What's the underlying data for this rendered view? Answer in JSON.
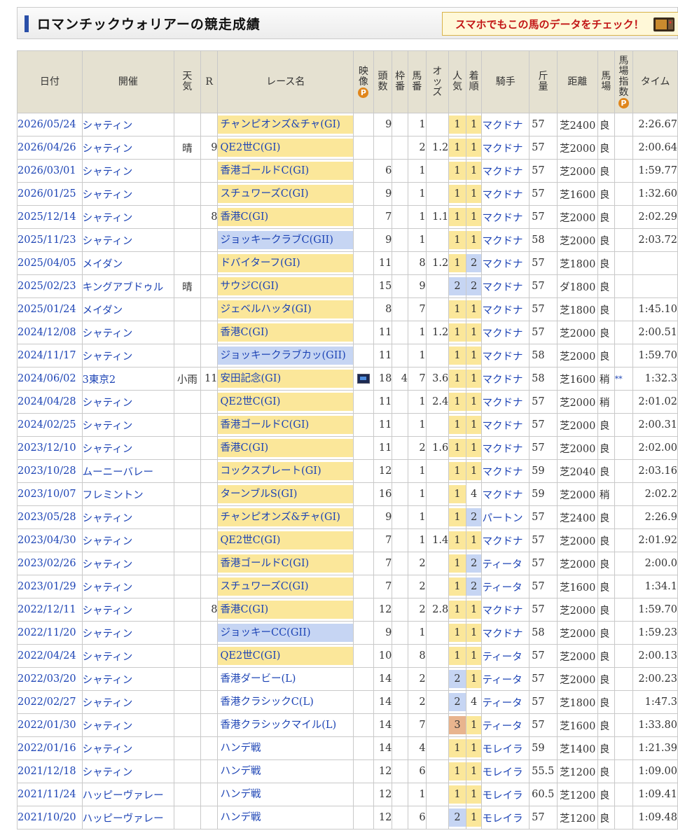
{
  "page": {
    "title": "ロマンチックウォリアーの競走成績"
  },
  "banner": {
    "text": "スマホでもこの馬のデータをチェック！"
  },
  "icons": {
    "premium": "P",
    "video": "video-icon"
  },
  "headers": {
    "date": "日付",
    "venue": "開催",
    "weather": "天気",
    "race_no": "R",
    "race_name": "レース名",
    "video": "映像",
    "field_size": "頭数",
    "gate": "枠番",
    "horse_no": "馬番",
    "odds": "オッズ",
    "popularity": "人気",
    "finish": "着順",
    "jockey": "騎手",
    "weight": "斤量",
    "distance": "距離",
    "track": "馬場",
    "speed_index": "馬場指数",
    "time": "タイム"
  },
  "rows": [
    {
      "date": "2026/05/24",
      "venue": "シャティン",
      "weather": "",
      "race_no": "",
      "race": "チャンピオンズ&チャ(GI)",
      "grade": "G1",
      "video": false,
      "field": "9",
      "gate": "",
      "horse_no": "1",
      "odds": "",
      "pop": "1",
      "finish": "1",
      "jockey": "マクドナ",
      "weight": "57",
      "distance": "芝2400",
      "track": "良",
      "index": "",
      "time": "2:26.67"
    },
    {
      "date": "2026/04/26",
      "venue": "シャティン",
      "weather": "晴",
      "race_no": "9",
      "race": "QE2世C(GI)",
      "grade": "G1",
      "video": false,
      "field": "",
      "gate": "",
      "horse_no": "2",
      "odds": "1.2",
      "pop": "1",
      "finish": "1",
      "jockey": "マクドナ",
      "weight": "57",
      "distance": "芝2000",
      "track": "良",
      "index": "",
      "time": "2:00.64"
    },
    {
      "date": "2026/03/01",
      "venue": "シャティン",
      "weather": "",
      "race_no": "",
      "race": "香港ゴールドC(GI)",
      "grade": "G1",
      "video": false,
      "field": "6",
      "gate": "",
      "horse_no": "1",
      "odds": "",
      "pop": "1",
      "finish": "1",
      "jockey": "マクドナ",
      "weight": "57",
      "distance": "芝2000",
      "track": "良",
      "index": "",
      "time": "1:59.77"
    },
    {
      "date": "2026/01/25",
      "venue": "シャティン",
      "weather": "",
      "race_no": "",
      "race": "スチュワーズC(GI)",
      "grade": "G1",
      "video": false,
      "field": "9",
      "gate": "",
      "horse_no": "1",
      "odds": "",
      "pop": "1",
      "finish": "1",
      "jockey": "マクドナ",
      "weight": "57",
      "distance": "芝1600",
      "track": "良",
      "index": "",
      "time": "1:32.60"
    },
    {
      "date": "2025/12/14",
      "venue": "シャティン",
      "weather": "",
      "race_no": "8",
      "race": "香港C(GI)",
      "grade": "G1",
      "video": false,
      "field": "7",
      "gate": "",
      "horse_no": "1",
      "odds": "1.1",
      "pop": "1",
      "finish": "1",
      "jockey": "マクドナ",
      "weight": "57",
      "distance": "芝2000",
      "track": "良",
      "index": "",
      "time": "2:02.29"
    },
    {
      "date": "2025/11/23",
      "venue": "シャティン",
      "weather": "",
      "race_no": "",
      "race": "ジョッキークラブC(GII)",
      "grade": "G2",
      "video": false,
      "field": "9",
      "gate": "",
      "horse_no": "1",
      "odds": "",
      "pop": "1",
      "finish": "1",
      "jockey": "マクドナ",
      "weight": "58",
      "distance": "芝2000",
      "track": "良",
      "index": "",
      "time": "2:03.72"
    },
    {
      "date": "2025/04/05",
      "venue": "メイダン",
      "weather": "",
      "race_no": "",
      "race": "ドバイターフ(GI)",
      "grade": "G1",
      "video": false,
      "field": "11",
      "gate": "",
      "horse_no": "8",
      "odds": "1.2",
      "pop": "1",
      "finish": "2",
      "jockey": "マクドナ",
      "weight": "57",
      "distance": "芝1800",
      "track": "良",
      "index": "",
      "time": ""
    },
    {
      "date": "2025/02/23",
      "venue": "キングアブドゥル",
      "weather": "晴",
      "race_no": "",
      "race": "サウジC(GI)",
      "grade": "G1",
      "video": false,
      "field": "15",
      "gate": "",
      "horse_no": "9",
      "odds": "",
      "pop": "2",
      "finish": "2",
      "jockey": "マクドナ",
      "weight": "57",
      "distance": "ダ1800",
      "track": "良",
      "index": "",
      "time": ""
    },
    {
      "date": "2025/01/24",
      "venue": "メイダン",
      "weather": "",
      "race_no": "",
      "race": "ジェベルハッタ(GI)",
      "grade": "G1",
      "video": false,
      "field": "8",
      "gate": "",
      "horse_no": "7",
      "odds": "",
      "pop": "1",
      "finish": "1",
      "jockey": "マクドナ",
      "weight": "57",
      "distance": "芝1800",
      "track": "良",
      "index": "",
      "time": "1:45.10"
    },
    {
      "date": "2024/12/08",
      "venue": "シャティン",
      "weather": "",
      "race_no": "",
      "race": "香港C(GI)",
      "grade": "G1",
      "video": false,
      "field": "11",
      "gate": "",
      "horse_no": "1",
      "odds": "1.2",
      "pop": "1",
      "finish": "1",
      "jockey": "マクドナ",
      "weight": "57",
      "distance": "芝2000",
      "track": "良",
      "index": "",
      "time": "2:00.51"
    },
    {
      "date": "2024/11/17",
      "venue": "シャティン",
      "weather": "",
      "race_no": "",
      "race": "ジョッキークラブカッ(GII)",
      "grade": "G2",
      "video": false,
      "field": "11",
      "gate": "",
      "horse_no": "1",
      "odds": "",
      "pop": "1",
      "finish": "1",
      "jockey": "マクドナ",
      "weight": "58",
      "distance": "芝2000",
      "track": "良",
      "index": "",
      "time": "1:59.70"
    },
    {
      "date": "2024/06/02",
      "venue": "3東京2",
      "weather": "小雨",
      "race_no": "11",
      "race": "安田記念(GI)",
      "grade": "G1",
      "video": true,
      "field": "18",
      "gate": "4",
      "horse_no": "7",
      "odds": "3.6",
      "pop": "1",
      "finish": "1",
      "jockey": "マクドナ",
      "weight": "58",
      "distance": "芝1600",
      "track": "稍",
      "index": "**",
      "time": "1:32.3"
    },
    {
      "date": "2024/04/28",
      "venue": "シャティン",
      "weather": "",
      "race_no": "",
      "race": "QE2世C(GI)",
      "grade": "G1",
      "video": false,
      "field": "11",
      "gate": "",
      "horse_no": "1",
      "odds": "2.4",
      "pop": "1",
      "finish": "1",
      "jockey": "マクドナ",
      "weight": "57",
      "distance": "芝2000",
      "track": "稍",
      "index": "",
      "time": "2:01.02"
    },
    {
      "date": "2024/02/25",
      "venue": "シャティン",
      "weather": "",
      "race_no": "",
      "race": "香港ゴールドC(GI)",
      "grade": "G1",
      "video": false,
      "field": "11",
      "gate": "",
      "horse_no": "1",
      "odds": "",
      "pop": "1",
      "finish": "1",
      "jockey": "マクドナ",
      "weight": "57",
      "distance": "芝2000",
      "track": "良",
      "index": "",
      "time": "2:00.31"
    },
    {
      "date": "2023/12/10",
      "venue": "シャティン",
      "weather": "",
      "race_no": "",
      "race": "香港C(GI)",
      "grade": "G1",
      "video": false,
      "field": "11",
      "gate": "",
      "horse_no": "2",
      "odds": "1.6",
      "pop": "1",
      "finish": "1",
      "jockey": "マクドナ",
      "weight": "57",
      "distance": "芝2000",
      "track": "良",
      "index": "",
      "time": "2:02.00"
    },
    {
      "date": "2023/10/28",
      "venue": "ムーニーバレー",
      "weather": "",
      "race_no": "",
      "race": "コックスプレート(GI)",
      "grade": "G1",
      "video": false,
      "field": "12",
      "gate": "",
      "horse_no": "1",
      "odds": "",
      "pop": "1",
      "finish": "1",
      "jockey": "マクドナ",
      "weight": "59",
      "distance": "芝2040",
      "track": "良",
      "index": "",
      "time": "2:03.16"
    },
    {
      "date": "2023/10/07",
      "venue": "フレミントン",
      "weather": "",
      "race_no": "",
      "race": "ターンブルS(GI)",
      "grade": "G1",
      "video": false,
      "field": "16",
      "gate": "",
      "horse_no": "1",
      "odds": "",
      "pop": "1",
      "finish": "4",
      "jockey": "マクドナ",
      "weight": "59",
      "distance": "芝2000",
      "track": "稍",
      "index": "",
      "time": "2:02.2"
    },
    {
      "date": "2023/05/28",
      "venue": "シャティン",
      "weather": "",
      "race_no": "",
      "race": "チャンピオンズ&チャ(GI)",
      "grade": "G1",
      "video": false,
      "field": "9",
      "gate": "",
      "horse_no": "1",
      "odds": "",
      "pop": "1",
      "finish": "2",
      "jockey": "パートン",
      "weight": "57",
      "distance": "芝2400",
      "track": "良",
      "index": "",
      "time": "2:26.9"
    },
    {
      "date": "2023/04/30",
      "venue": "シャティン",
      "weather": "",
      "race_no": "",
      "race": "QE2世C(GI)",
      "grade": "G1",
      "video": false,
      "field": "7",
      "gate": "",
      "horse_no": "1",
      "odds": "1.4",
      "pop": "1",
      "finish": "1",
      "jockey": "マクドナ",
      "weight": "57",
      "distance": "芝2000",
      "track": "良",
      "index": "",
      "time": "2:01.92"
    },
    {
      "date": "2023/02/26",
      "venue": "シャティン",
      "weather": "",
      "race_no": "",
      "race": "香港ゴールドC(GI)",
      "grade": "G1",
      "video": false,
      "field": "7",
      "gate": "",
      "horse_no": "2",
      "odds": "",
      "pop": "1",
      "finish": "2",
      "jockey": "ティータ",
      "weight": "57",
      "distance": "芝2000",
      "track": "良",
      "index": "",
      "time": "2:00.0"
    },
    {
      "date": "2023/01/29",
      "venue": "シャティン",
      "weather": "",
      "race_no": "",
      "race": "スチュワーズC(GI)",
      "grade": "G1",
      "video": false,
      "field": "7",
      "gate": "",
      "horse_no": "2",
      "odds": "",
      "pop": "1",
      "finish": "2",
      "jockey": "ティータ",
      "weight": "57",
      "distance": "芝1600",
      "track": "良",
      "index": "",
      "time": "1:34.1"
    },
    {
      "date": "2022/12/11",
      "venue": "シャティン",
      "weather": "",
      "race_no": "8",
      "race": "香港C(GI)",
      "grade": "G1",
      "video": false,
      "field": "12",
      "gate": "",
      "horse_no": "2",
      "odds": "2.8",
      "pop": "1",
      "finish": "1",
      "jockey": "マクドナ",
      "weight": "57",
      "distance": "芝2000",
      "track": "良",
      "index": "",
      "time": "1:59.70"
    },
    {
      "date": "2022/11/20",
      "venue": "シャティン",
      "weather": "",
      "race_no": "",
      "race": "ジョッキーCC(GII)",
      "grade": "G2",
      "video": false,
      "field": "9",
      "gate": "",
      "horse_no": "1",
      "odds": "",
      "pop": "1",
      "finish": "1",
      "jockey": "マクドナ",
      "weight": "58",
      "distance": "芝2000",
      "track": "良",
      "index": "",
      "time": "1:59.23"
    },
    {
      "date": "2022/04/24",
      "venue": "シャティン",
      "weather": "",
      "race_no": "",
      "race": "QE2世C(GI)",
      "grade": "G1",
      "video": false,
      "field": "10",
      "gate": "",
      "horse_no": "8",
      "odds": "",
      "pop": "1",
      "finish": "1",
      "jockey": "ティータ",
      "weight": "57",
      "distance": "芝2000",
      "track": "良",
      "index": "",
      "time": "2:00.13"
    },
    {
      "date": "2022/03/20",
      "venue": "シャティン",
      "weather": "",
      "race_no": "",
      "race": "香港ダービー(L)",
      "grade": "",
      "video": false,
      "field": "14",
      "gate": "",
      "horse_no": "2",
      "odds": "",
      "pop": "2",
      "finish": "1",
      "jockey": "ティータ",
      "weight": "57",
      "distance": "芝2000",
      "track": "良",
      "index": "",
      "time": "2:00.23"
    },
    {
      "date": "2022/02/27",
      "venue": "シャティン",
      "weather": "",
      "race_no": "",
      "race": "香港クラシックC(L)",
      "grade": "",
      "video": false,
      "field": "14",
      "gate": "",
      "horse_no": "2",
      "odds": "",
      "pop": "2",
      "finish": "4",
      "jockey": "ティータ",
      "weight": "57",
      "distance": "芝1800",
      "track": "良",
      "index": "",
      "time": "1:47.3"
    },
    {
      "date": "2022/01/30",
      "venue": "シャティン",
      "weather": "",
      "race_no": "",
      "race": "香港クラシックマイル(L)",
      "grade": "",
      "video": false,
      "field": "14",
      "gate": "",
      "horse_no": "7",
      "odds": "",
      "pop": "3",
      "finish": "1",
      "jockey": "ティータ",
      "weight": "57",
      "distance": "芝1600",
      "track": "良",
      "index": "",
      "time": "1:33.80"
    },
    {
      "date": "2022/01/16",
      "venue": "シャティン",
      "weather": "",
      "race_no": "",
      "race": "ハンデ戦",
      "grade": "",
      "video": false,
      "field": "14",
      "gate": "",
      "horse_no": "4",
      "odds": "",
      "pop": "1",
      "finish": "1",
      "jockey": "モレイラ",
      "weight": "59",
      "distance": "芝1400",
      "track": "良",
      "index": "",
      "time": "1:21.39"
    },
    {
      "date": "2021/12/18",
      "venue": "シャティン",
      "weather": "",
      "race_no": "",
      "race": "ハンデ戦",
      "grade": "",
      "video": false,
      "field": "12",
      "gate": "",
      "horse_no": "6",
      "odds": "",
      "pop": "1",
      "finish": "1",
      "jockey": "モレイラ",
      "weight": "55.5",
      "distance": "芝1200",
      "track": "良",
      "index": "",
      "time": "1:09.00"
    },
    {
      "date": "2021/11/24",
      "venue": "ハッピーヴァレー",
      "weather": "",
      "race_no": "",
      "race": "ハンデ戦",
      "grade": "",
      "video": false,
      "field": "12",
      "gate": "",
      "horse_no": "1",
      "odds": "",
      "pop": "1",
      "finish": "1",
      "jockey": "モレイラ",
      "weight": "60.5",
      "distance": "芝1200",
      "track": "良",
      "index": "",
      "time": "1:09.41"
    },
    {
      "date": "2021/10/20",
      "venue": "ハッピーヴァレー",
      "weather": "",
      "race_no": "",
      "race": "ハンデ戦",
      "grade": "",
      "video": false,
      "field": "12",
      "gate": "",
      "horse_no": "6",
      "odds": "",
      "pop": "2",
      "finish": "1",
      "jockey": "モレイラ",
      "weight": "57",
      "distance": "芝1200",
      "track": "良",
      "index": "",
      "time": "1:09.48"
    }
  ]
}
